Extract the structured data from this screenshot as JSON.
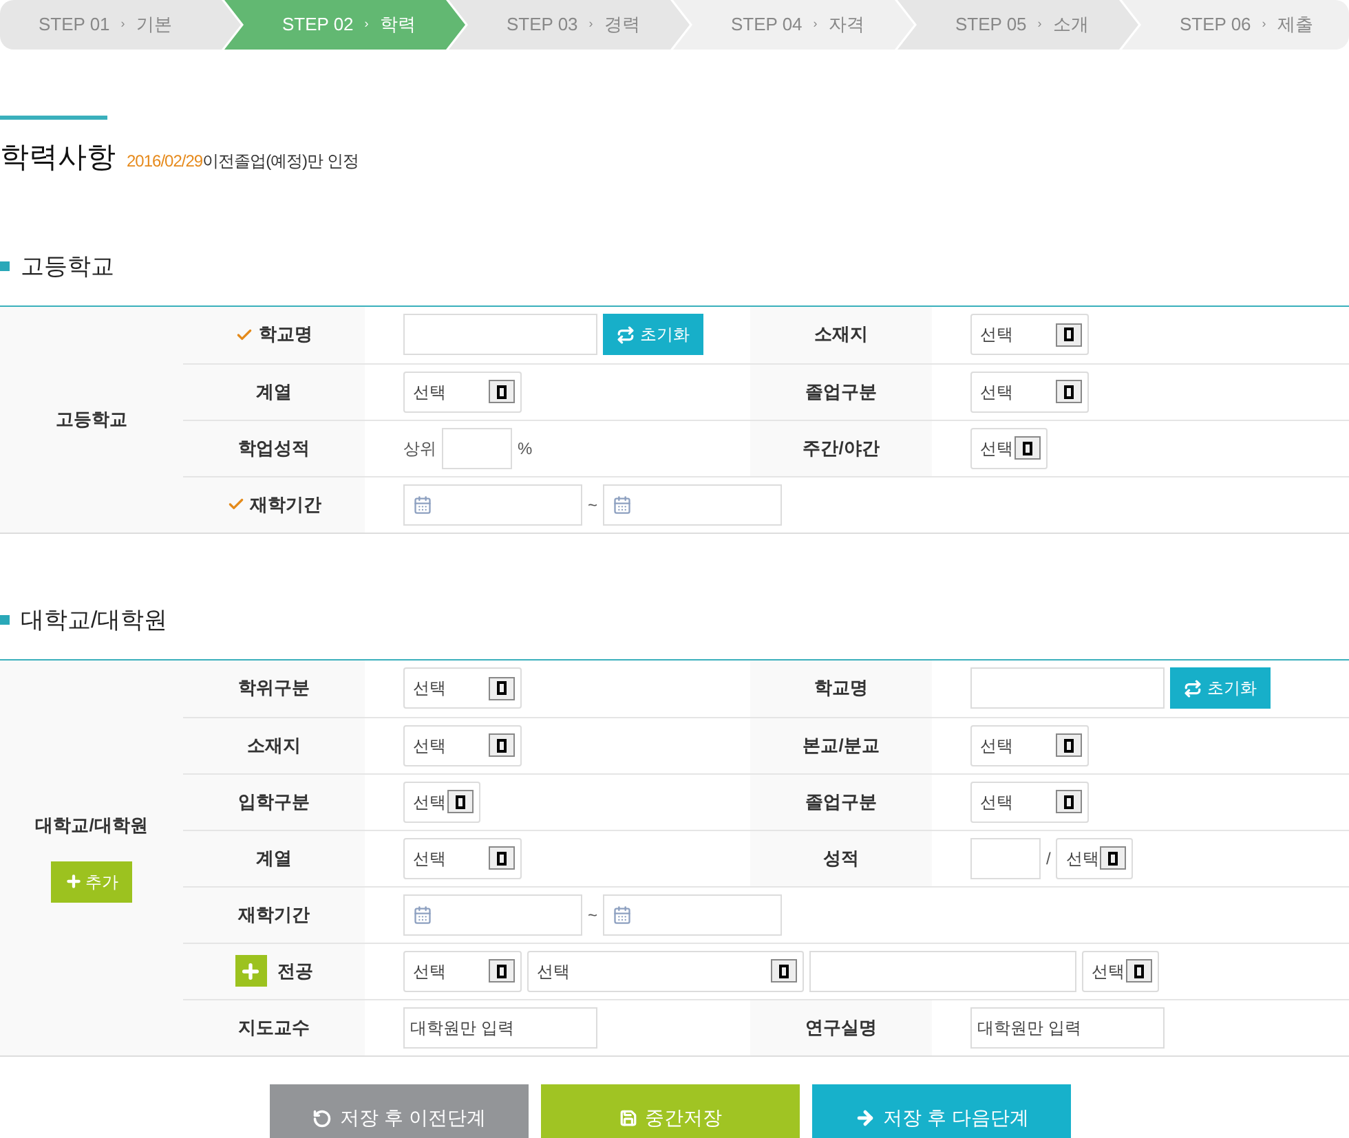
{
  "steps": [
    {
      "number": "STEP 01",
      "separator": "›",
      "label": "기본",
      "selected": false
    },
    {
      "number": "STEP 02",
      "separator": "›",
      "label": "학력",
      "selected": true
    },
    {
      "number": "STEP 03",
      "separator": "›",
      "label": "경력",
      "selected": false
    },
    {
      "number": "STEP 04",
      "separator": "›",
      "label": "자격",
      "selected": false
    },
    {
      "number": "STEP 05",
      "separator": "›",
      "label": "소개",
      "selected": false
    },
    {
      "number": "STEP 06",
      "separator": "›",
      "label": "제출",
      "selected": false
    }
  ],
  "title": "학력사항",
  "note_date": "2016/02/29",
  "note_text": "이전졸업(예정)만 인정",
  "sections": [
    {
      "heading": "고등학교",
      "group_label": "고등학교",
      "rows": [
        {
          "cells": [
            {
              "label": "학교명",
              "required": true,
              "add": false,
              "controls": [
                {
                  "kind": "text"
                },
                {
                  "kind": "reset",
                  "label": "초기화"
                }
              ]
            },
            {
              "label": "소재지",
              "required": false,
              "add": false,
              "controls": [
                {
                  "kind": "select",
                  "value": "선택"
                }
              ]
            }
          ]
        },
        {
          "cells": [
            {
              "label": "계열",
              "required": false,
              "add": false,
              "controls": [
                {
                  "kind": "select",
                  "value": "선택"
                }
              ]
            },
            {
              "label": "졸업구분",
              "required": false,
              "add": false,
              "controls": [
                {
                  "kind": "select",
                  "value": "선택"
                }
              ]
            }
          ]
        },
        {
          "cells": [
            {
              "label": "학업성적",
              "required": false,
              "add": false,
              "controls": [
                {
                  "kind": "plain",
                  "text": "상위"
                },
                {
                  "kind": "shorttext"
                },
                {
                  "kind": "plain",
                  "text": "%"
                }
              ]
            },
            {
              "label": "주간/야간",
              "required": false,
              "add": false,
              "controls": [
                {
                  "kind": "compactselect",
                  "value": "선택"
                }
              ]
            }
          ]
        },
        {
          "cells": [
            {
              "label": "재학기간",
              "required": true,
              "add": false,
              "controls": [
                {
                  "kind": "date"
                },
                {
                  "kind": "plain",
                  "text": "~"
                },
                {
                  "kind": "date"
                }
              ]
            }
          ]
        }
      ]
    },
    {
      "heading": "대학교/대학원",
      "group_label": "대학교/대학원",
      "group_button": "추가",
      "rows": [
        {
          "cells": [
            {
              "label": "학위구분",
              "required": false,
              "add": false,
              "controls": [
                {
                  "kind": "select",
                  "value": "선택"
                }
              ]
            },
            {
              "label": "학교명",
              "required": false,
              "add": false,
              "controls": [
                {
                  "kind": "text"
                },
                {
                  "kind": "reset",
                  "label": "초기화"
                }
              ]
            }
          ]
        },
        {
          "cells": [
            {
              "label": "소재지",
              "required": false,
              "add": false,
              "controls": [
                {
                  "kind": "select",
                  "value": "선택"
                }
              ]
            },
            {
              "label": "본교/분교",
              "required": false,
              "add": false,
              "controls": [
                {
                  "kind": "select",
                  "value": "선택"
                }
              ]
            }
          ]
        },
        {
          "cells": [
            {
              "label": "입학구분",
              "required": false,
              "add": false,
              "controls": [
                {
                  "kind": "compactselect",
                  "value": "선택"
                }
              ]
            },
            {
              "label": "졸업구분",
              "required": false,
              "add": false,
              "controls": [
                {
                  "kind": "select",
                  "value": "선택"
                }
              ]
            }
          ]
        },
        {
          "cells": [
            {
              "label": "계열",
              "required": false,
              "add": false,
              "controls": [
                {
                  "kind": "select",
                  "value": "선택"
                }
              ]
            },
            {
              "label": "성적",
              "required": false,
              "add": false,
              "controls": [
                {
                  "kind": "shorttext"
                },
                {
                  "kind": "plain",
                  "text": "/"
                },
                {
                  "kind": "compactselect",
                  "value": "선택"
                }
              ]
            }
          ]
        },
        {
          "cells": [
            {
              "label": "재학기간",
              "required": false,
              "add": false,
              "controls": [
                {
                  "kind": "date"
                },
                {
                  "kind": "plain",
                  "text": "~"
                },
                {
                  "kind": "date"
                }
              ]
            }
          ]
        },
        {
          "cells": [
            {
              "label": "전공",
              "required": false,
              "add": true,
              "controls": [
                {
                  "kind": "select",
                  "value": "선택"
                },
                {
                  "kind": "wideselect",
                  "value": "선택"
                },
                {
                  "kind": "widetext"
                },
                {
                  "kind": "compactselect",
                  "value": "선택"
                }
              ]
            }
          ]
        },
        {
          "cells": [
            {
              "label": "지도교수",
              "required": false,
              "add": false,
              "controls": [
                {
                  "kind": "text",
                  "placeholder": "대학원만 입력"
                }
              ]
            },
            {
              "label": "연구실명",
              "required": false,
              "add": false,
              "controls": [
                {
                  "kind": "text",
                  "placeholder": "대학원만 입력"
                }
              ]
            }
          ]
        }
      ]
    }
  ],
  "buttons": [
    {
      "kind": "prev",
      "label": "저장 후 이전단계"
    },
    {
      "kind": "save",
      "label": "중간저장"
    },
    {
      "kind": "next",
      "label": "저장 후 다음단계"
    }
  ]
}
